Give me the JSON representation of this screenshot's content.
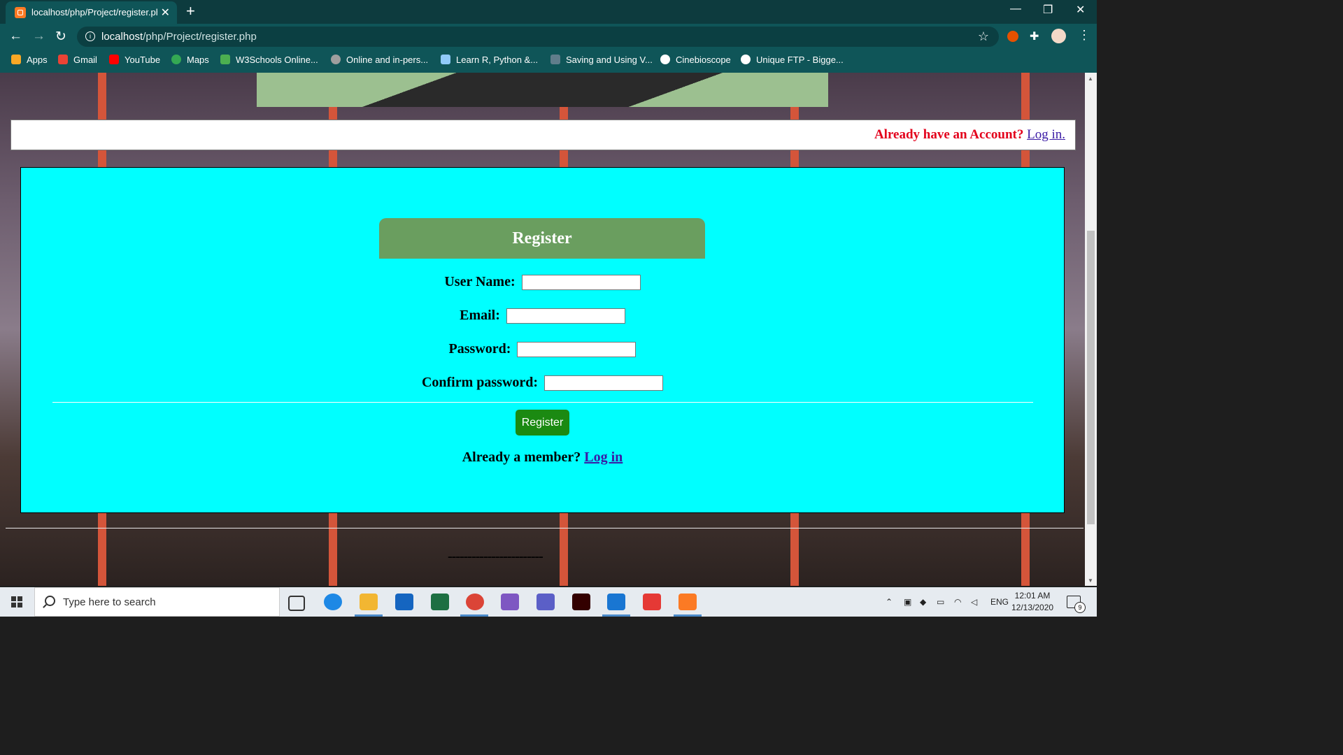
{
  "browser": {
    "tab_title": "localhost/php/Project/register.ph",
    "url_host": "localhost",
    "url_path": "/php/Project/register.php",
    "bookmarks": [
      {
        "label": "Apps",
        "icon": "apps-grid-icon",
        "color": "#f9a825"
      },
      {
        "label": "Gmail",
        "icon": "gmail-icon",
        "color": "#ea4335"
      },
      {
        "label": "YouTube",
        "icon": "youtube-icon",
        "color": "#ff0000"
      },
      {
        "label": "Maps",
        "icon": "maps-pin-icon",
        "color": "#34a853"
      },
      {
        "label": "W3Schools Online...",
        "icon": "w3schools-icon",
        "color": "#4caf50"
      },
      {
        "label": "Online and in-pers...",
        "icon": "loader-icon",
        "color": "#9e9e9e"
      },
      {
        "label": "Learn R, Python &...",
        "icon": "shield-icon",
        "color": "#90caf9"
      },
      {
        "label": "Saving and Using V...",
        "icon": "pen-icon",
        "color": "#607d8b"
      },
      {
        "label": "Cinebioscope",
        "icon": "globe-icon",
        "color": "#ffffff"
      },
      {
        "label": "Unique FTP - Bigge...",
        "icon": "globe-icon",
        "color": "#ffffff"
      }
    ]
  },
  "page": {
    "already_account": "Already have an Account?",
    "login_link": "Log in.",
    "form": {
      "header": "Register",
      "username_label": "User Name:",
      "email_label": "Email:",
      "password_label": "Password:",
      "confirm_label": "Confirm password:",
      "submit_label": "Register",
      "member_text": "Already a member?",
      "member_link": "Log in"
    },
    "dashes": "------------------------",
    "colors": {
      "card_bg": "#00ffff",
      "header_bg": "#6a9e5f",
      "button_bg": "#1b8a12",
      "account_text": "#e3001b"
    }
  },
  "taskbar": {
    "search_placeholder": "Type here to search",
    "language": "ENG",
    "time": "12:01 AM",
    "date": "12/13/2020",
    "notifications": "9"
  }
}
